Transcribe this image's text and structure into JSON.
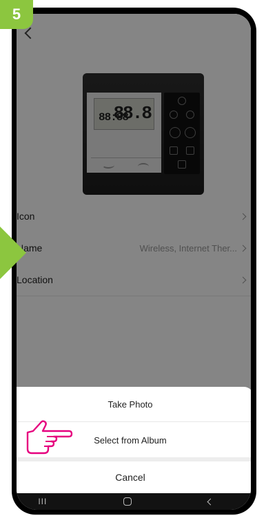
{
  "step": {
    "number": "5"
  },
  "header": {
    "back_icon": "chevron-left-icon"
  },
  "device_image": {
    "lcd_small": "88:88",
    "lcd_big": "88.8"
  },
  "list": [
    {
      "label": "Icon",
      "value": ""
    },
    {
      "label": "Name",
      "value": "Wireless, Internet Ther..."
    },
    {
      "label": "Location",
      "value": ""
    }
  ],
  "sheet": {
    "take_photo": "Take Photo",
    "select_album": "Select from Album",
    "cancel": "Cancel"
  },
  "navbar": {
    "recent_icon": "III"
  },
  "colors": {
    "accent": "#8cc63f",
    "pointer": "#e6007e"
  }
}
